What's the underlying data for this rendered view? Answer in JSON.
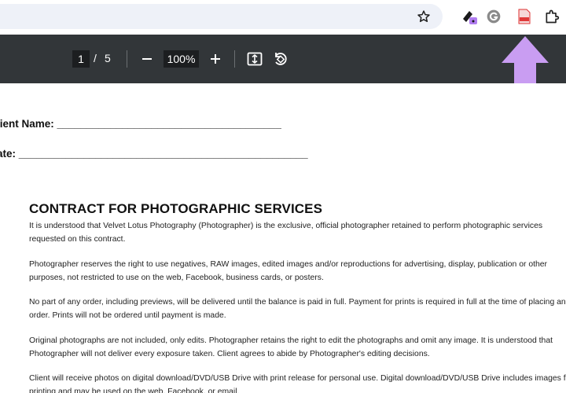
{
  "toolbar": {
    "current_page": "1",
    "page_separator": "/",
    "total_pages": "5",
    "zoom": "100%"
  },
  "document": {
    "client_field": "lient Name: ______________________________________",
    "date_field": "ate: _________________________________________________",
    "title": "CONTRACT FOR PHOTOGRAPHIC SERVICES",
    "paragraphs": [
      "It is understood that Velvet Lotus Photography (Photographer) is the exclusive, official photographer retained to perform photographic services requested on this contract.",
      "Photographer reserves the right to use negatives, RAW images, edited images and/or reproductions for advertising, display, publication or other purposes, not restricted to use on the web, Facebook, business cards, or posters.",
      "No part of any order, including previews, will be delivered until the balance is paid in full. Payment for prints is required in full at the time of placing an order. Prints will not be ordered until payment is made.",
      "Original photographs are not included, only edits. Photographer retains the right to edit the photographs and omit any image. It is understood that Photographer will not deliver every exposure taken. Client agrees to abide by Photographer's editing decisions.",
      "Client will receive photos on digital download/DVD/USB Drive with print release for personal use. Digital download/DVD/USB Drive includes images for printing and may be used on the web, Facebook, or email."
    ]
  },
  "colors": {
    "toolbar_bg": "#323639",
    "omnibox_bg": "#eef1f8",
    "arrow": "#c99df2"
  }
}
